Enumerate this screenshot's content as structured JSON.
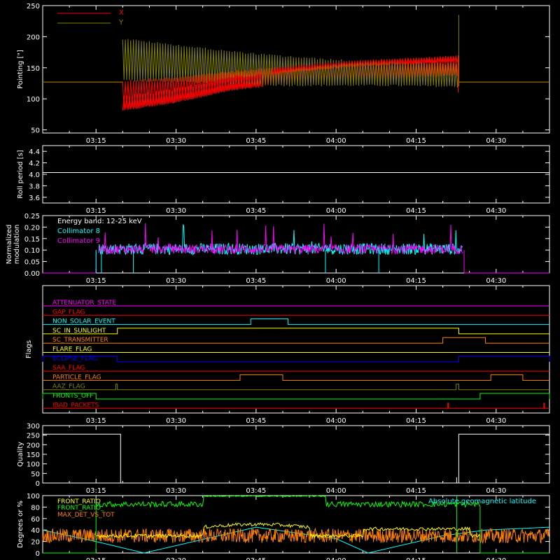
{
  "chart_data": [
    {
      "id": "pointing",
      "type": "line",
      "ylabel": "Pointing [\"]",
      "ylim": [
        45,
        250
      ],
      "yticks": [
        50,
        100,
        150,
        200,
        250
      ],
      "xlim": [
        "03:05",
        "04:40"
      ],
      "xticks": [
        "03:15",
        "03:30",
        "03:45",
        "04:00",
        "04:15",
        "04:30"
      ],
      "legend_placement": "top-left",
      "series": [
        {
          "name": "X",
          "color": "#ff0000",
          "baseline": 127,
          "envelope": [
            {
              "t": "03:20",
              "lo": 80,
              "hi": 130
            },
            {
              "t": "03:30",
              "lo": 93,
              "hi": 136
            },
            {
              "t": "03:40",
              "lo": 112,
              "hi": 145
            },
            {
              "t": "03:50",
              "lo": 122,
              "hi": 152
            },
            {
              "t": "04:00",
              "lo": 127,
              "hi": 160
            },
            {
              "t": "04:10",
              "lo": 130,
              "hi": 165
            },
            {
              "t": "04:23",
              "lo": 136,
              "hi": 170
            }
          ]
        },
        {
          "name": "Y",
          "color": "#808000",
          "baseline": 127,
          "envelope": [
            {
              "t": "03:20",
              "lo": 128,
              "hi": 198
            },
            {
              "t": "03:30",
              "lo": 126,
              "hi": 188
            },
            {
              "t": "03:40",
              "lo": 124,
              "hi": 178
            },
            {
              "t": "03:50",
              "lo": 120,
              "hi": 170
            },
            {
              "t": "04:00",
              "lo": 120,
              "hi": 164
            },
            {
              "t": "04:10",
              "lo": 120,
              "hi": 160
            },
            {
              "t": "04:23",
              "lo": 118,
              "hi": 157
            }
          ]
        }
      ]
    },
    {
      "id": "roll",
      "type": "line",
      "ylabel": "Roll period [s]",
      "ylim": [
        3.5,
        4.5
      ],
      "yticks": [
        3.6,
        3.8,
        4.0,
        4.2,
        4.4
      ],
      "ytick_labels": [
        "3.6",
        "3.8",
        "4.0",
        "4.2",
        "4.4"
      ],
      "xticks": [
        "03:15",
        "03:30",
        "03:45",
        "04:00",
        "04:15",
        "04:30"
      ],
      "series": [
        {
          "name": "",
          "color": "#ffffff",
          "value": 4.03
        }
      ]
    },
    {
      "id": "modulation",
      "type": "line",
      "ylabel": "Normalized modulation",
      "ylim": [
        0,
        0.25
      ],
      "yticks": [
        0.0,
        0.05,
        0.1,
        0.15,
        0.2,
        0.25
      ],
      "ytick_labels": [
        "0.00",
        "0.05",
        "0.10",
        "0.15",
        "0.20",
        "0.25"
      ],
      "xticks": [
        "03:15",
        "03:30",
        "03:45",
        "04:00",
        "04:15",
        "04:30"
      ],
      "annotation": "Energy band: 12-25 keV",
      "active_range": [
        "03:15",
        "04:24"
      ],
      "series": [
        {
          "name": "Collimator 8",
          "color": "#00ffff",
          "mean": 0.1,
          "spread": 0.05,
          "dropouts": [
            "03:15",
            "03:16",
            "03:22",
            "03:58",
            "04:08"
          ]
        },
        {
          "name": "Collimator 9",
          "color": "#ff00ff",
          "mean": 0.1,
          "spread": 0.04
        }
      ]
    },
    {
      "id": "flags",
      "type": "line",
      "ylabel": "Flags",
      "xticks": [
        "03:15",
        "03:30",
        "03:45",
        "04:00",
        "04:15",
        "04:30"
      ],
      "flags": [
        {
          "label": "ATTENUATOR_STATE",
          "color": "#ff00ff",
          "segments": []
        },
        {
          "label": "GAP_FLAG",
          "color": "#ff0000",
          "segments": []
        },
        {
          "label": "NON_SOLAR_EVENT",
          "color": "#00ffff",
          "segments": [
            [
              "03:44",
              "03:51"
            ]
          ]
        },
        {
          "label": "SC_IN_SUNLIGHT",
          "color": "#ffff00",
          "segments": [
            [
              "03:19",
              "04:23"
            ]
          ]
        },
        {
          "label": "SC_TRANSMITTER",
          "color": "#ff8000",
          "segments": [
            [
              "04:20",
              "04:28"
            ]
          ]
        },
        {
          "label": "FLARE_FLAG",
          "color": "#ffff00",
          "segments": []
        },
        {
          "label": "ECLIPSE_FLAG",
          "color": "#0000ff",
          "segments": [
            [
              "03:05",
              "03:19"
            ],
            [
              "04:23",
              "04:40"
            ]
          ]
        },
        {
          "label": "SAA_FLAG",
          "color": "#ff0000",
          "segments": []
        },
        {
          "label": "PARTICLE_FLAG",
          "color": "#ff8000",
          "segments": [
            [
              "03:42",
              "03:50"
            ],
            [
              "04:29",
              "04:35"
            ]
          ]
        },
        {
          "label": "AAZ_FLAG",
          "color": "#808000",
          "segments": [
            [
              "03:18.7",
              "03:19"
            ],
            [
              "04:22.5",
              "04:23"
            ]
          ]
        },
        {
          "label": "FRONTS_OFF",
          "color": "#00ff00",
          "segments": [
            [
              "03:05",
              "03:15"
            ],
            [
              "04:27",
              "04:40"
            ]
          ]
        },
        {
          "label": "IBAD_PACKETS",
          "color": "#ff0000",
          "spikes": [
            "04:21",
            "04:39"
          ]
        }
      ]
    },
    {
      "id": "quality",
      "type": "line",
      "ylabel": "Quality",
      "ylim": [
        0,
        300
      ],
      "yticks": [
        0,
        50,
        100,
        150,
        200,
        250,
        300
      ],
      "xticks": [
        "03:15",
        "03:30",
        "03:45",
        "04:00",
        "04:15",
        "04:30"
      ],
      "series": [
        {
          "name": "",
          "color": "#ffffff",
          "points": [
            [
              "03:05",
              255
            ],
            [
              "03:19.6",
              255
            ],
            [
              "03:19.6",
              0
            ],
            [
              "04:23",
              0
            ],
            [
              "04:23",
              255
            ],
            [
              "04:40",
              255
            ]
          ]
        }
      ]
    },
    {
      "id": "latitude",
      "type": "line",
      "ylabel": "Degrees or %",
      "ylim": [
        0,
        100
      ],
      "yticks": [
        0,
        20,
        40,
        60,
        80,
        100
      ],
      "xticks": [
        "03:15",
        "03:30",
        "03:45",
        "04:00",
        "04:15",
        "04:30"
      ],
      "series": [
        {
          "name": "FRONT_RATIO",
          "color": "#ffff00"
        },
        {
          "name": "FRONT_RATIO_",
          "color": "#00ff00"
        },
        {
          "name": "MAX_DET_VS_TOT",
          "color": "#ff8000"
        },
        {
          "name": "Absolute geomagnetic latitude",
          "color": "#00ffff"
        }
      ]
    }
  ]
}
